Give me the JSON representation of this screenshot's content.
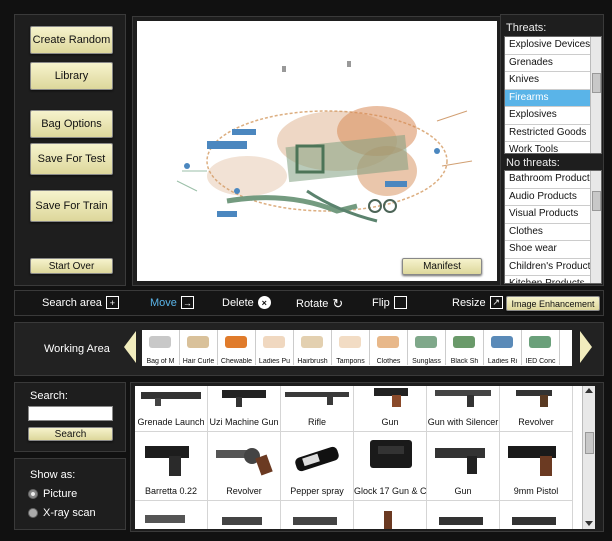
{
  "left_buttons": {
    "create_random": "Create Random",
    "library": "Library",
    "bag_options": "Bag Options",
    "save_for_test": "Save For Test",
    "save_for_train": "Save For Train",
    "start_over": "Start Over"
  },
  "viewer": {
    "manifest_button": "Manifest"
  },
  "threats": {
    "label": "Threats:",
    "items": [
      "Explosive Devices",
      "Grenades",
      "Knives",
      "Firearms",
      "Explosives",
      "Restricted Goods",
      "Work Tools"
    ],
    "selected": "Firearms"
  },
  "no_threats": {
    "label": "No threats:",
    "items": [
      "Bathroom Products",
      "Audio Products",
      "Visual Products",
      "Clothes",
      "Shoe wear",
      "Children's Products",
      "Kitchen Products"
    ]
  },
  "toolbar": {
    "search_area": "Search area",
    "move": "Move",
    "delete": "Delete",
    "rotate": "Rotate",
    "flip": "Flip",
    "resize": "Resize",
    "image_enhancement": "Image Enhancement"
  },
  "working_area": {
    "label": "Working Area",
    "items": [
      "Bag of M",
      "Hair Curle",
      "Chewable",
      "Ladies Pu",
      "Hairbrush",
      "Tampons",
      "Clothes",
      "Sunglass",
      "Black Sh",
      "Ladies Ri",
      "IED Conc"
    ]
  },
  "search": {
    "label": "Search:",
    "value": "",
    "button": "Search"
  },
  "show_as": {
    "label": "Show as:",
    "options": [
      "Picture",
      "X-ray scan"
    ],
    "selected": "Picture"
  },
  "grid": {
    "row1": [
      "Grenade Launch",
      "Uzi Machine Gun",
      "Rifle",
      "Gun",
      "Gun with Silencer",
      "Revolver"
    ],
    "row2": [
      "Barretta 0.22",
      "Revolver",
      "Pepper spray",
      "Glock 17 Gun & C",
      "Gun",
      "9mm Pistol"
    ]
  },
  "colors": {
    "accent": "#5ab4e8",
    "button": "#ece7b4",
    "move_label": "#5ab4e8"
  }
}
